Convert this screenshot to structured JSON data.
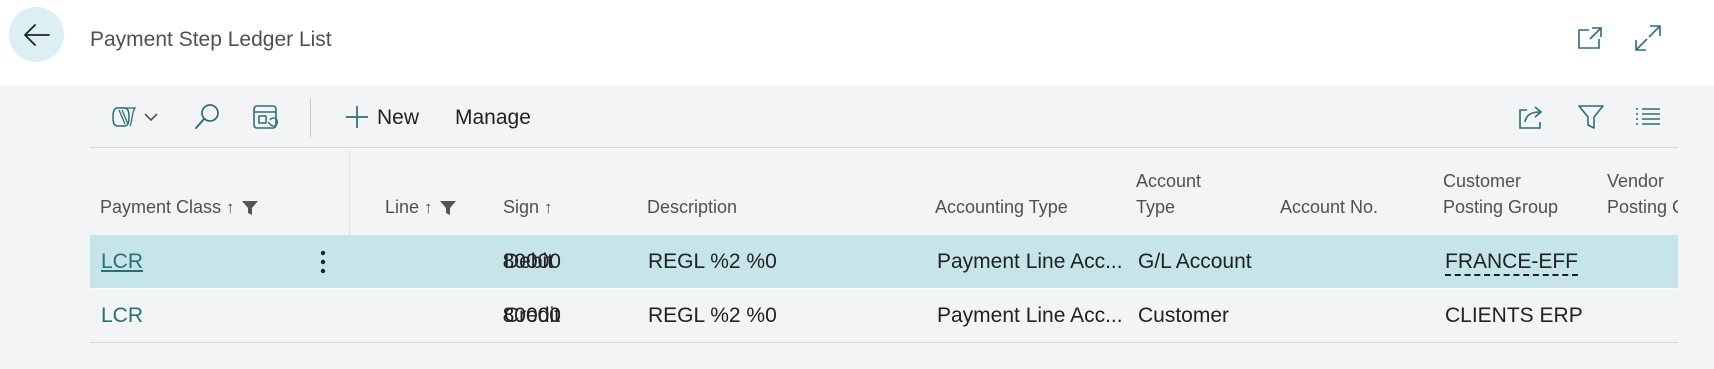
{
  "header": {
    "title": "Payment Step Ledger List",
    "back_icon": "arrow-left-icon",
    "open_new_icon": "open-in-new-window-icon",
    "expand_icon": "expand-icon"
  },
  "actionbar": {
    "copilot_icon": "copilot-icon",
    "search_icon": "search-icon",
    "edit_list_icon": "edit-list-icon",
    "new_label": "New",
    "manage_label": "Manage",
    "share_icon": "share-icon",
    "filter_icon": "filter-icon",
    "list_view_icon": "list-view-icon"
  },
  "columns": {
    "payment_class": "Payment Class",
    "line": "Line",
    "sign": "Sign",
    "description": "Description",
    "accounting_type": "Accounting Type",
    "account_type_1": "Account",
    "account_type_2": "Type",
    "account_no": "Account No.",
    "customer_posting_1": "Customer",
    "customer_posting_2": "Posting Group",
    "vendor_posting_1": "Vendor",
    "vendor_posting_2": "Posting G",
    "sort_arrow": "↑"
  },
  "rows": [
    {
      "payment_class": "LCR",
      "line": "80000",
      "sign": "Debit",
      "description": "REGL %2 %0",
      "accounting_type": "Payment Line Acc...",
      "account_type": "G/L Account",
      "account_no": "",
      "customer_posting_group": "FRANCE-EFF",
      "vendor_posting_group": ""
    },
    {
      "payment_class": "LCR",
      "line": "80000",
      "sign": "Credit",
      "description": "REGL %2 %0",
      "accounting_type": "Payment Line Acc...",
      "account_type": "Customer",
      "account_no": "",
      "customer_posting_group": "CLIENTS ERP",
      "vendor_posting_group": ""
    }
  ],
  "colors": {
    "accent": "#2a6f78",
    "selected_row": "#c5e5e9",
    "back_button_bg": "#dceff2",
    "content_bg": "#f3f4f5"
  }
}
